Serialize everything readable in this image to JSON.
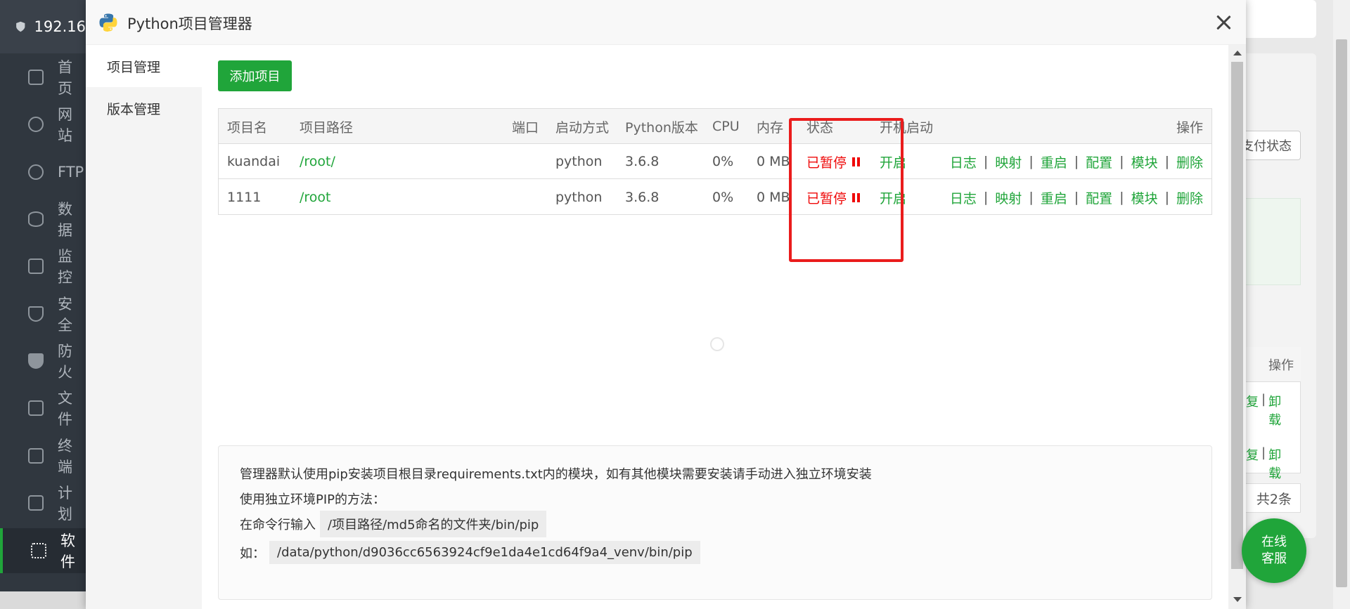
{
  "background": {
    "logo_text": "192.16",
    "nav": [
      {
        "label": "首页"
      },
      {
        "label": "网站"
      },
      {
        "label": "FTP"
      },
      {
        "label": "数据"
      },
      {
        "label": "监控"
      },
      {
        "label": "安全"
      },
      {
        "label": "防火"
      },
      {
        "label": "文件"
      },
      {
        "label": "终端"
      },
      {
        "label": "计划"
      },
      {
        "label": "软件"
      }
    ],
    "pay_status_btn": "支付状态",
    "table_op_header": "操作",
    "row_links": [
      {
        "a": "复",
        "b": "卸载"
      },
      {
        "a": "复",
        "b": "卸载"
      }
    ],
    "total": "共2条"
  },
  "chat_button": {
    "line1": "在线",
    "line2": "客服"
  },
  "modal": {
    "title": "Python项目管理器",
    "side_tabs": [
      {
        "label": "项目管理"
      },
      {
        "label": "版本管理"
      }
    ],
    "add_button": "添加项目",
    "table": {
      "headers": {
        "name": "项目名",
        "path": "项目路径",
        "port": "端口",
        "start": "启动方式",
        "version": "Python版本",
        "cpu": "CPU",
        "mem": "内存",
        "status": "状态",
        "boot": "开机启动",
        "ops": "操作"
      },
      "rows": [
        {
          "name": "kuandai",
          "path": "/root/",
          "port": "",
          "start": "python",
          "version": "3.6.8",
          "cpu": "0%",
          "mem": "0 MB",
          "status": "已暂停",
          "boot": "开启"
        },
        {
          "name": "1111",
          "path": "/root",
          "port": "",
          "start": "python",
          "version": "3.6.8",
          "cpu": "0%",
          "mem": "0 MB",
          "status": "已暂停",
          "boot": "开启"
        }
      ],
      "op_links": [
        "日志",
        "映射",
        "重启",
        "配置",
        "模块",
        "删除"
      ],
      "op_separator": "|"
    },
    "info": {
      "line1": "管理器默认使用pip安装项目根目录requirements.txt内的模块，如有其他模块需要安装请手动进入独立环境安装",
      "line2": "使用独立环境PIP的方法：",
      "line3_label": "在命令行输入",
      "line3_code": "/项目路径/md5命名的文件夹/bin/pip",
      "line4_label": "如：",
      "line4_code": "/data/python/d9036cc6563924cf9e1da4e1cd64f9a4_venv/bin/pip"
    },
    "colors": {
      "accent": "#20a53a",
      "danger": "#ef0808",
      "highlight": "#ea1c1c"
    }
  }
}
